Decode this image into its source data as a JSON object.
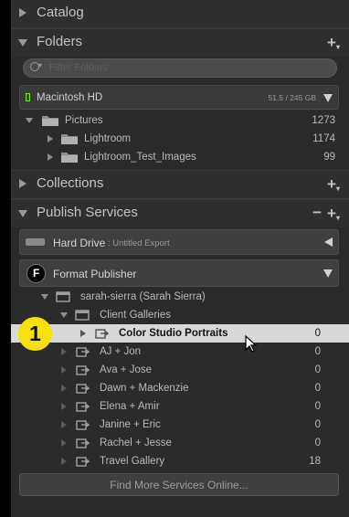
{
  "sections": {
    "catalog": "Catalog",
    "folders": "Folders",
    "collections": "Collections",
    "publish_services": "Publish Services"
  },
  "folders": {
    "filter_placeholder": "Filter Folders",
    "volume": {
      "name": "Macintosh HD",
      "space": "51.5 / 245 GB"
    },
    "items": [
      {
        "label": "Pictures",
        "count": "1273"
      },
      {
        "label": "Lightroom",
        "count": "1174"
      },
      {
        "label": "Lightroom_Test_Images",
        "count": "99"
      }
    ]
  },
  "publish": {
    "hard_drive": {
      "name": "Hard Drive",
      "sub": " : Untitled Export"
    },
    "format": {
      "logo": "F",
      "name": "Format Publisher"
    },
    "account": "sarah-sierra (Sarah Sierra)",
    "client_galleries": "Client Galleries",
    "collections": [
      {
        "label": "Color Studio Portraits",
        "count": "0"
      },
      {
        "label": "AJ + Jon",
        "count": "0"
      },
      {
        "label": "Ava + Jose",
        "count": "0"
      },
      {
        "label": "Dawn + Mackenzie",
        "count": "0"
      },
      {
        "label": "Elena + Amir",
        "count": "0"
      },
      {
        "label": "Janine + Eric",
        "count": "0"
      },
      {
        "label": "Rachel + Jesse",
        "count": "0"
      },
      {
        "label": "Travel Gallery",
        "count": "18"
      }
    ],
    "find_more": "Find More Services Online..."
  },
  "badge": {
    "number": "1",
    "color": "#f4e20a"
  },
  "colors": {
    "panel": "#2b2b2b",
    "selected_row": "#d8d8d8"
  }
}
